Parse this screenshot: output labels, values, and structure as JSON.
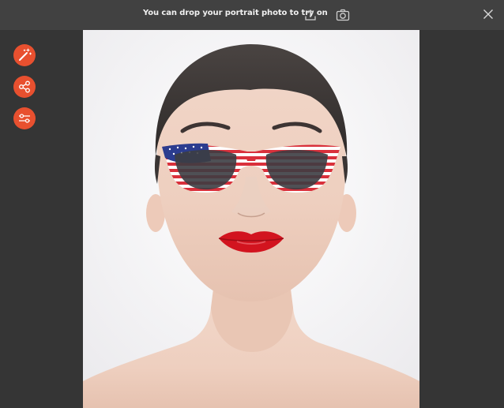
{
  "toolbar": {
    "hint_text": "You can drop your portrait photo to try on",
    "upload_icon": "upload-icon",
    "camera_icon": "camera-icon",
    "close_icon": "close-icon"
  },
  "sidebar": {
    "buttons": [
      {
        "icon": "magic-wand-icon"
      },
      {
        "icon": "share-icon"
      },
      {
        "icon": "sliders-icon"
      }
    ]
  },
  "colors": {
    "accent": "#e8502f",
    "topbar_bg": "#414141",
    "panel_bg": "#353535",
    "photo_bg": "#f2f2f3"
  }
}
